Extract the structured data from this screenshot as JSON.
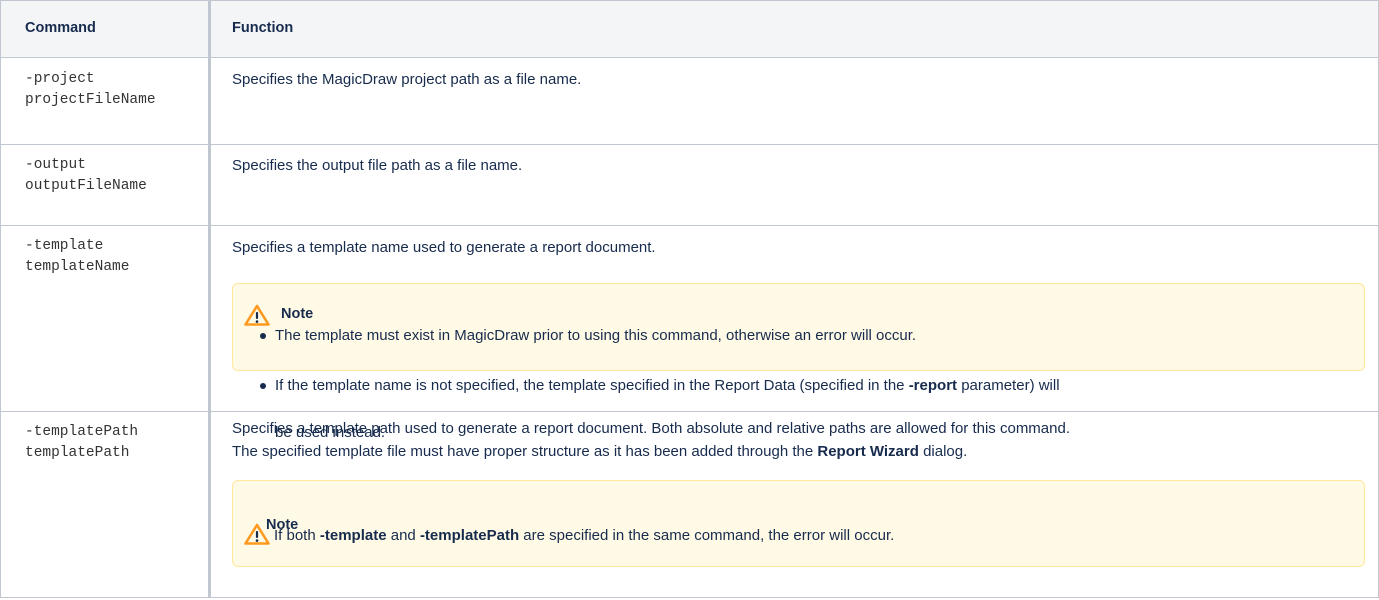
{
  "header": {
    "command": "Command",
    "function": "Function"
  },
  "rows": [
    {
      "cmd1": "-project",
      "cmd2": "projectFileName",
      "description": "Specifies the MagicDraw project path as a file name."
    },
    {
      "cmd1": "-output",
      "cmd2": "outputFileName",
      "description": "Specifies the output file path as a file name."
    },
    {
      "cmd1": "-template",
      "cmd2": "templateName",
      "description": "Specifies a template name used to generate a report document.",
      "note": {
        "title": "Note",
        "bullet1": "The template must exist in MagicDraw prior to using this command, otherwise an error will occur.",
        "bullet2_a": "If the template name is not specified, the template specified in the Report Data (specified in the ",
        "bullet2_b": "-report",
        "bullet2_c": " parameter) will",
        "bullet2_d": "be used instead."
      }
    },
    {
      "cmd1": "-templatePath",
      "cmd2": "templatePath",
      "line1": "Specifies a template path used to generate a report document. Both absolute and relative paths are allowed for this command.",
      "line2_a": "The specified template file must have proper structure as it has been added through the ",
      "line2_b": "Report Wizard",
      "line2_c": " dialog.",
      "note": {
        "title": "Note",
        "text_a": "If both ",
        "text_b": "-template",
        "text_c": " and ",
        "text_d": "-templatePath",
        "text_e": " are specified in the same command, the error will occur."
      }
    }
  ],
  "colors": {
    "border": "#c1c7d0",
    "header_bg": "#f4f5f7",
    "note_bg": "#fffae6",
    "note_border": "#ffe89c",
    "warning": "#ff991f"
  }
}
